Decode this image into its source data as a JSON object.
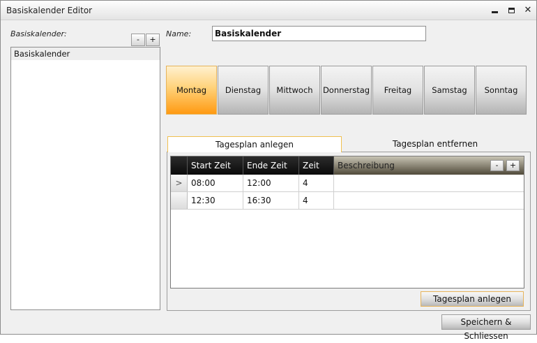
{
  "window": {
    "title": "Basiskalender Editor",
    "controls": {
      "minimize": "minimize-icon",
      "maximize": "maximize-icon",
      "close": "✕"
    }
  },
  "left": {
    "label": "Basiskalender:",
    "remove_label": "-",
    "add_label": "+",
    "items": [
      "Basiskalender"
    ]
  },
  "name": {
    "label": "Name:",
    "value": "Basiskalender"
  },
  "days": {
    "active": "Montag",
    "items": [
      "Montag",
      "Dienstag",
      "Mittwoch",
      "Donnerstag",
      "Freitag",
      "Samstag",
      "Sonntag"
    ]
  },
  "tabs": [
    {
      "label": "Tagesplan anlegen",
      "active": true
    },
    {
      "label": "Tagesplan entfernen",
      "active": false
    }
  ],
  "grid": {
    "columns": [
      "Start Zeit",
      "Ende Zeit",
      "Zeit",
      "Beschreibung"
    ],
    "remove_label": "-",
    "add_label": "+",
    "current_row_marker": ">",
    "rows": [
      {
        "start": "08:00",
        "end": "12:00",
        "zeit": "4",
        "beschreibung": ""
      },
      {
        "start": "12:30",
        "end": "16:30",
        "zeit": "4",
        "beschreibung": ""
      }
    ]
  },
  "buttons": {
    "create_plan": "Tagesplan anlegen",
    "save_close": "Speichern & Schliessen"
  },
  "colors": {
    "active_day": "#ff9a12",
    "focus_border": "#e6b35a",
    "grid_header": "#1a1a1a"
  }
}
